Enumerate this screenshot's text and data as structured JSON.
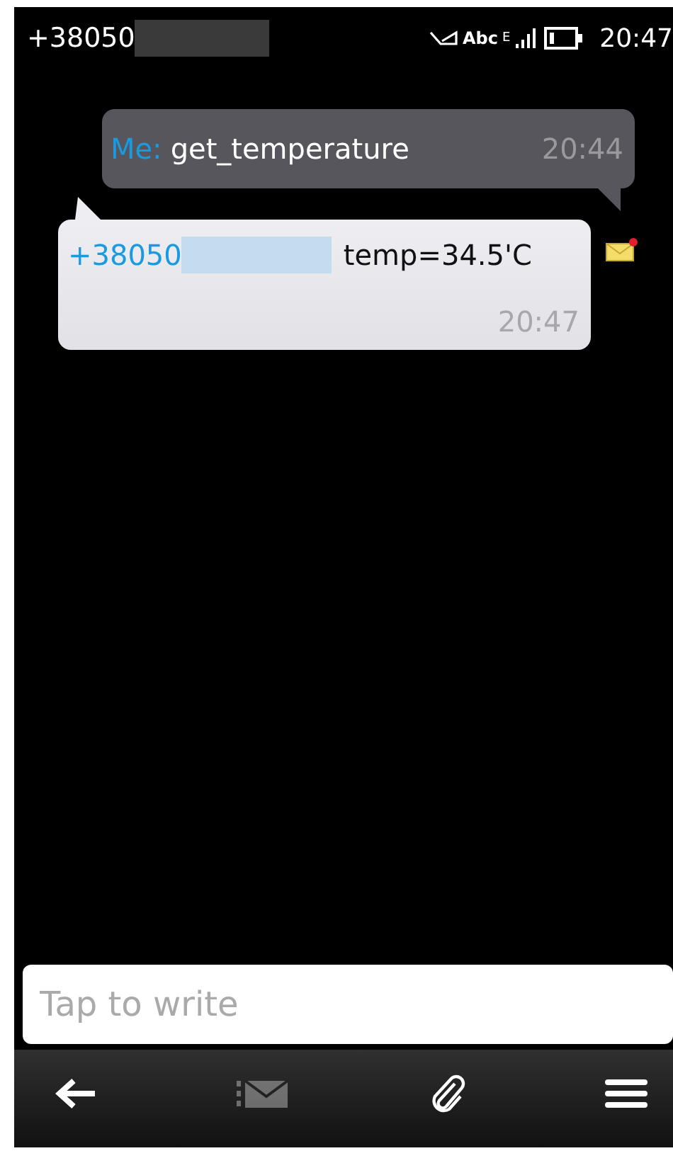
{
  "status_bar": {
    "contact": "+38050",
    "indicator_text": "Abc",
    "network": "E",
    "time": "20:47"
  },
  "messages": [
    {
      "kind": "sent",
      "sender": "Me:",
      "text": "get_temperature",
      "time": "20:44",
      "unread": false
    },
    {
      "kind": "received",
      "sender": "+38050",
      "text": "temp=34.5'C",
      "time": "20:47",
      "unread": true
    }
  ],
  "composer": {
    "placeholder": "Tap to write"
  },
  "toolbar": {
    "send_disabled": true
  }
}
